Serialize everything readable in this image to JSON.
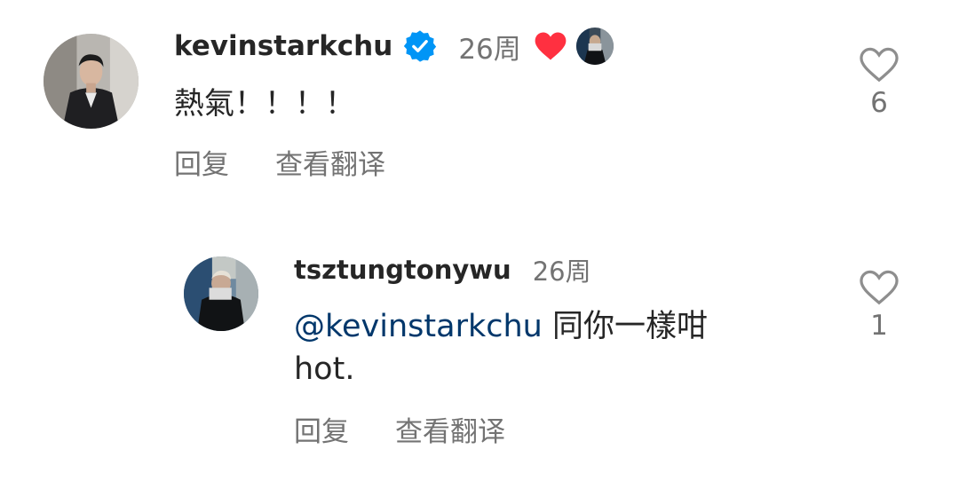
{
  "comment": {
    "username": "kevinstarkchu",
    "time": "26周",
    "text": "熱氣！！！！",
    "reply_label": "回复",
    "translate_label": "查看翻译",
    "like_count": "6",
    "creator_liked": true
  },
  "reply": {
    "username": "tsztungtonywu",
    "time": "26周",
    "mention": "@kevinstarkchu",
    "text": " 同你一樣咁",
    "text_line2": "hot.",
    "reply_label": "回复",
    "translate_label": "查看翻译",
    "like_count": "1"
  },
  "colors": {
    "verified": "#0095f6",
    "creator_heart": "#ff3040",
    "mention": "#00376b",
    "secondary_text": "#737373"
  },
  "icons": [
    "verified-badge-icon",
    "heart-filled-icon",
    "heart-outline-icon"
  ]
}
